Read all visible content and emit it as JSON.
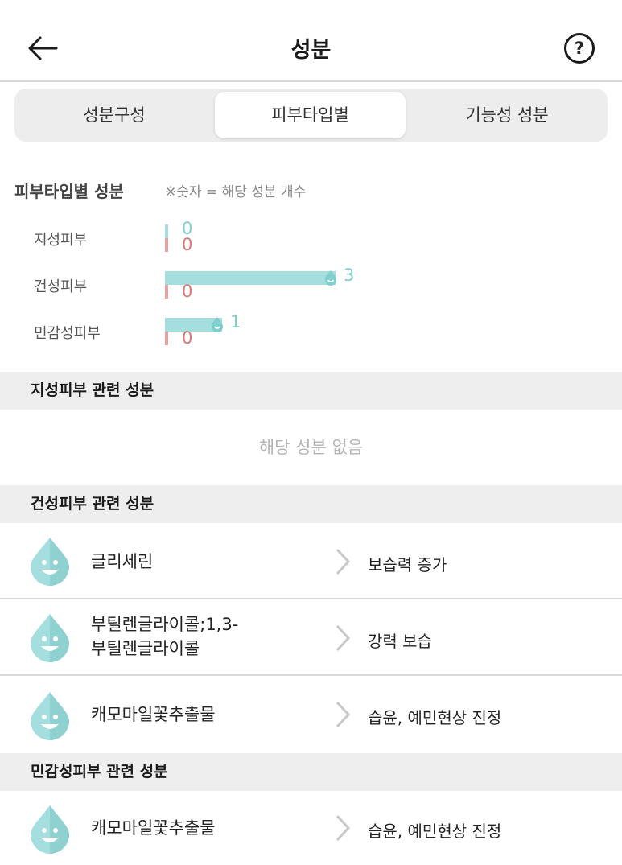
{
  "header": {
    "title": "성분"
  },
  "tabs": [
    {
      "label": "성분구성",
      "active": false
    },
    {
      "label": "피부타입별",
      "active": true
    },
    {
      "label": "기능성 성분",
      "active": false
    }
  ],
  "skin_chart": {
    "heading": "피부타입별 성분",
    "note": "※숫자 = 해당 성분 개수",
    "rows": [
      {
        "label": "지성피부",
        "good": 0,
        "bad": 0,
        "good_text": "0",
        "bad_text": "0"
      },
      {
        "label": "건성피부",
        "good": 3,
        "bad": 0,
        "good_text": "3",
        "bad_text": "0"
      },
      {
        "label": "민감성피부",
        "good": 1,
        "bad": 0,
        "good_text": "1",
        "bad_text": "0"
      }
    ],
    "colors": {
      "good": "#a4dede",
      "bad": "#e8a2a2"
    }
  },
  "sections": {
    "oily": {
      "title": "지성피부 관련 성분",
      "empty": "해당 성분 없음"
    },
    "dry": {
      "title": "건성피부 관련 성분",
      "items": [
        {
          "name_line1": "글리세린",
          "name_line2": "",
          "effect": "보습력 증가"
        },
        {
          "name_line1": "부틸렌글라이콜;1,3-",
          "name_line2": "부틸렌글라이콜",
          "effect": "강력 보습"
        },
        {
          "name_line1": "캐모마일꽃추출물",
          "name_line2": "",
          "effect": "습윤, 예민현상 진정"
        }
      ]
    },
    "sensitive": {
      "title": "민감성피부 관련 성분",
      "items": [
        {
          "name_line1": "캐모마일꽃추출물",
          "name_line2": "",
          "effect": "습윤, 예민현상 진정"
        }
      ]
    }
  },
  "icons": {
    "back": "back-arrow-icon",
    "help": "help-icon",
    "ingredient": "water-drop-smile-icon",
    "chevron": "chevron-right-icon"
  }
}
